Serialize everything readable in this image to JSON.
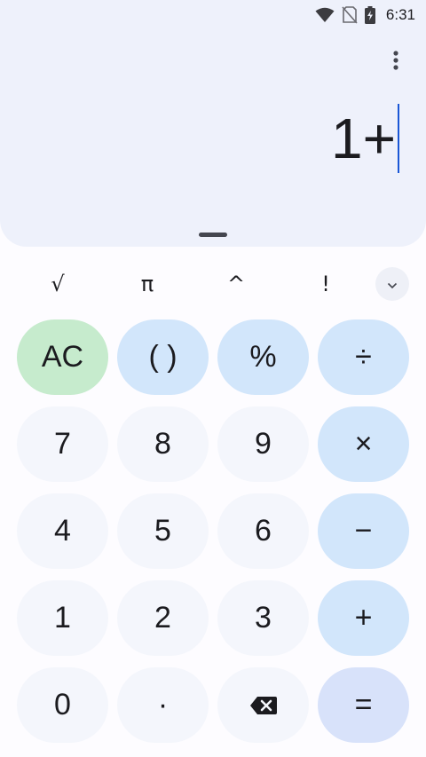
{
  "status_bar": {
    "time": "6:31",
    "icons": [
      "wifi-icon",
      "no-sim-icon",
      "battery-charging-icon"
    ]
  },
  "display": {
    "expression": "1+"
  },
  "scientific": {
    "sqrt": "√",
    "pi": "π",
    "power": "^",
    "factorial": "!"
  },
  "keys": {
    "clear": "AC",
    "parens": "( )",
    "percent": "%",
    "divide": "÷",
    "seven": "7",
    "eight": "8",
    "nine": "9",
    "multiply": "×",
    "four": "4",
    "five": "5",
    "six": "6",
    "minus": "−",
    "one": "1",
    "two": "2",
    "three": "3",
    "plus": "+",
    "zero": "0",
    "decimal": "·",
    "equals": "="
  },
  "colors": {
    "display_bg": "#eef1fb",
    "number_key": "#f4f6fc",
    "operator_key": "#d2e6fb",
    "clear_key": "#c6ebcd",
    "equals_key": "#d8e2fa",
    "cursor": "#1a57d6"
  }
}
